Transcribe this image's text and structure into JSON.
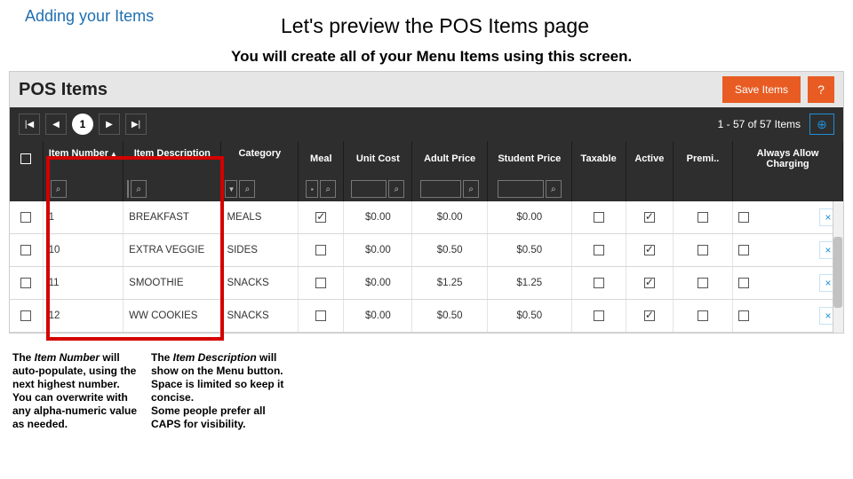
{
  "heading": "Adding your Items",
  "preview_title": "Let's preview the POS Items page",
  "preview_sub": "You will create all of your Menu Items using this screen.",
  "app": {
    "title": "POS Items",
    "save_label": "Save Items",
    "help_label": "?",
    "pager": {
      "current": "1",
      "range": "1 - 57 of 57 Items"
    },
    "add_label": "⊕",
    "columns": {
      "number": "Item Number",
      "desc": "Item Description",
      "cat": "Category",
      "meal": "Meal",
      "cost": "Unit Cost",
      "adult": "Adult Price",
      "student": "Student Price",
      "tax": "Taxable",
      "active": "Active",
      "prem": "Premi..",
      "allow": "Always Allow Charging"
    }
  },
  "rows": [
    {
      "num": "1",
      "desc": "BREAKFAST",
      "cat": "MEALS",
      "meal_checked": true,
      "cost": "$0.00",
      "adult": "$0.00",
      "student": "$0.00",
      "tax": false,
      "active": true,
      "prem": false,
      "allow": false
    },
    {
      "num": "10",
      "desc": "EXTRA VEGGIE",
      "cat": "SIDES",
      "meal_checked": false,
      "cost": "$0.00",
      "adult": "$0.50",
      "student": "$0.50",
      "tax": false,
      "active": true,
      "prem": false,
      "allow": false
    },
    {
      "num": "11",
      "desc": "SMOOTHIE",
      "cat": "SNACKS",
      "meal_checked": false,
      "cost": "$0.00",
      "adult": "$1.25",
      "student": "$1.25",
      "tax": false,
      "active": true,
      "prem": false,
      "allow": false
    },
    {
      "num": "12",
      "desc": "WW COOKIES",
      "cat": "SNACKS",
      "meal_checked": false,
      "cost": "$0.00",
      "adult": "$0.50",
      "student": "$0.50",
      "tax": false,
      "active": true,
      "prem": false,
      "allow": false
    }
  ],
  "notes": {
    "n1_title": "Item Number",
    "n1_body": "The <i>Item Number</i> will auto-populate, using the next highest number.<br>You can overwrite with any alpha-numeric value as needed.",
    "n2_title": "Item Description",
    "n2_body": "The <i>Item Description</i> will show on the Menu button. Space is limited so keep it concise.<br>Some people prefer all CAPS for visibility."
  }
}
